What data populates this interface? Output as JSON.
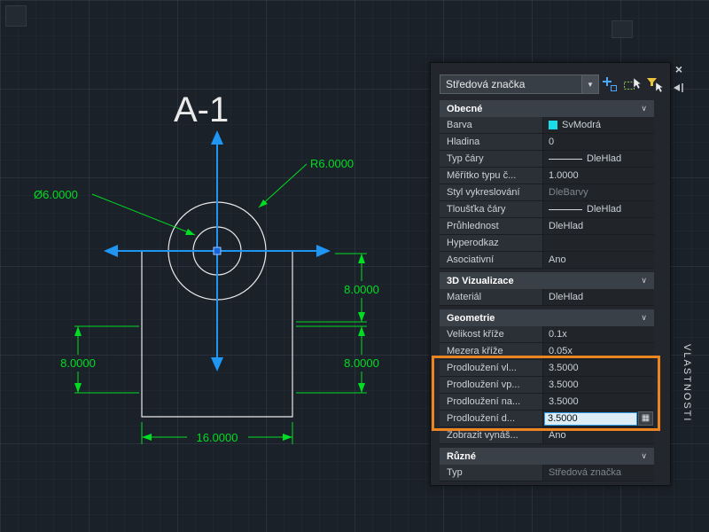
{
  "canvas": {
    "title": "A-1",
    "colors": {
      "geometry": "#e9e9e9",
      "dimension": "#00dd22",
      "centermark": "#1e96f2",
      "grip": "#1565d8",
      "grip_border": "#9cc6ff"
    },
    "dimensions": {
      "radius_label": "R6.0000",
      "diameter_label": "Ø6.0000",
      "right_upper": "8.0000",
      "left": "8.0000",
      "right_lower": "8.0000",
      "bottom": "16.0000"
    }
  },
  "palette": {
    "tab_title": "VLASTNOSTI",
    "selector_value": "Středová značka",
    "combo_arrow": "▼",
    "close_glyph": "×",
    "chevron_glyph": "∨",
    "calc_glyph": "▦",
    "sections": [
      {
        "title": "Obecné",
        "rows": [
          {
            "label": "Barva",
            "value": "SvModrá",
            "swatch": "#1adbe8"
          },
          {
            "label": "Hladina",
            "value": "0"
          },
          {
            "label": "Typ čáry",
            "value": "DleHlad"
          },
          {
            "label": "Měřítko typu č...",
            "value": "1.0000"
          },
          {
            "label": "Styl vykreslování",
            "value": "DleBarvy"
          },
          {
            "label": "Tloušťka čáry",
            "value": "DleHlad"
          },
          {
            "label": "Průhlednost",
            "value": "DleHlad"
          },
          {
            "label": "Hyperodkaz",
            "value": ""
          },
          {
            "label": "Asociativní",
            "value": "Ano"
          }
        ]
      },
      {
        "title": "3D Vizualizace",
        "rows": [
          {
            "label": "Materiál",
            "value": "DleHlad"
          }
        ]
      },
      {
        "title": "Geometrie",
        "rows": [
          {
            "label": "Velikost kříže",
            "value": "0.1x"
          },
          {
            "label": "Mezera kříže",
            "value": "0.05x"
          },
          {
            "label": "Prodloužení vl...",
            "value": "3.5000"
          },
          {
            "label": "Prodloužení vp...",
            "value": "3.5000"
          },
          {
            "label": "Prodloužení na...",
            "value": "3.5000"
          },
          {
            "label": "Prodloužení d...",
            "value": "3.5000"
          },
          {
            "label": "Zobrazit vynáš...",
            "value": "Ano"
          }
        ]
      },
      {
        "title": "Různé",
        "rows": [
          {
            "label": "Typ",
            "value": "Středová značka"
          }
        ]
      }
    ]
  }
}
